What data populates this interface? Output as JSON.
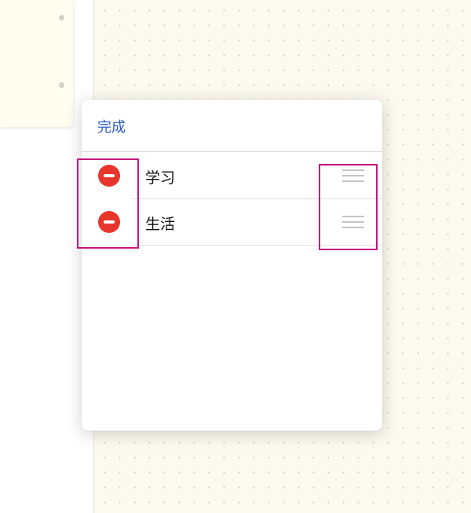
{
  "popover": {
    "done_label": "完成"
  },
  "categories": [
    {
      "label": "学习",
      "delete_icon": "minus-circle-icon",
      "reorder_icon": "drag-handle-icon"
    },
    {
      "label": "生活",
      "delete_icon": "minus-circle-icon",
      "reorder_icon": "drag-handle-icon"
    }
  ],
  "colors": {
    "accent": "#2a5bc4",
    "delete": "#e8352c",
    "highlight": "#c6157e",
    "canvas": "#fcf9ef"
  }
}
